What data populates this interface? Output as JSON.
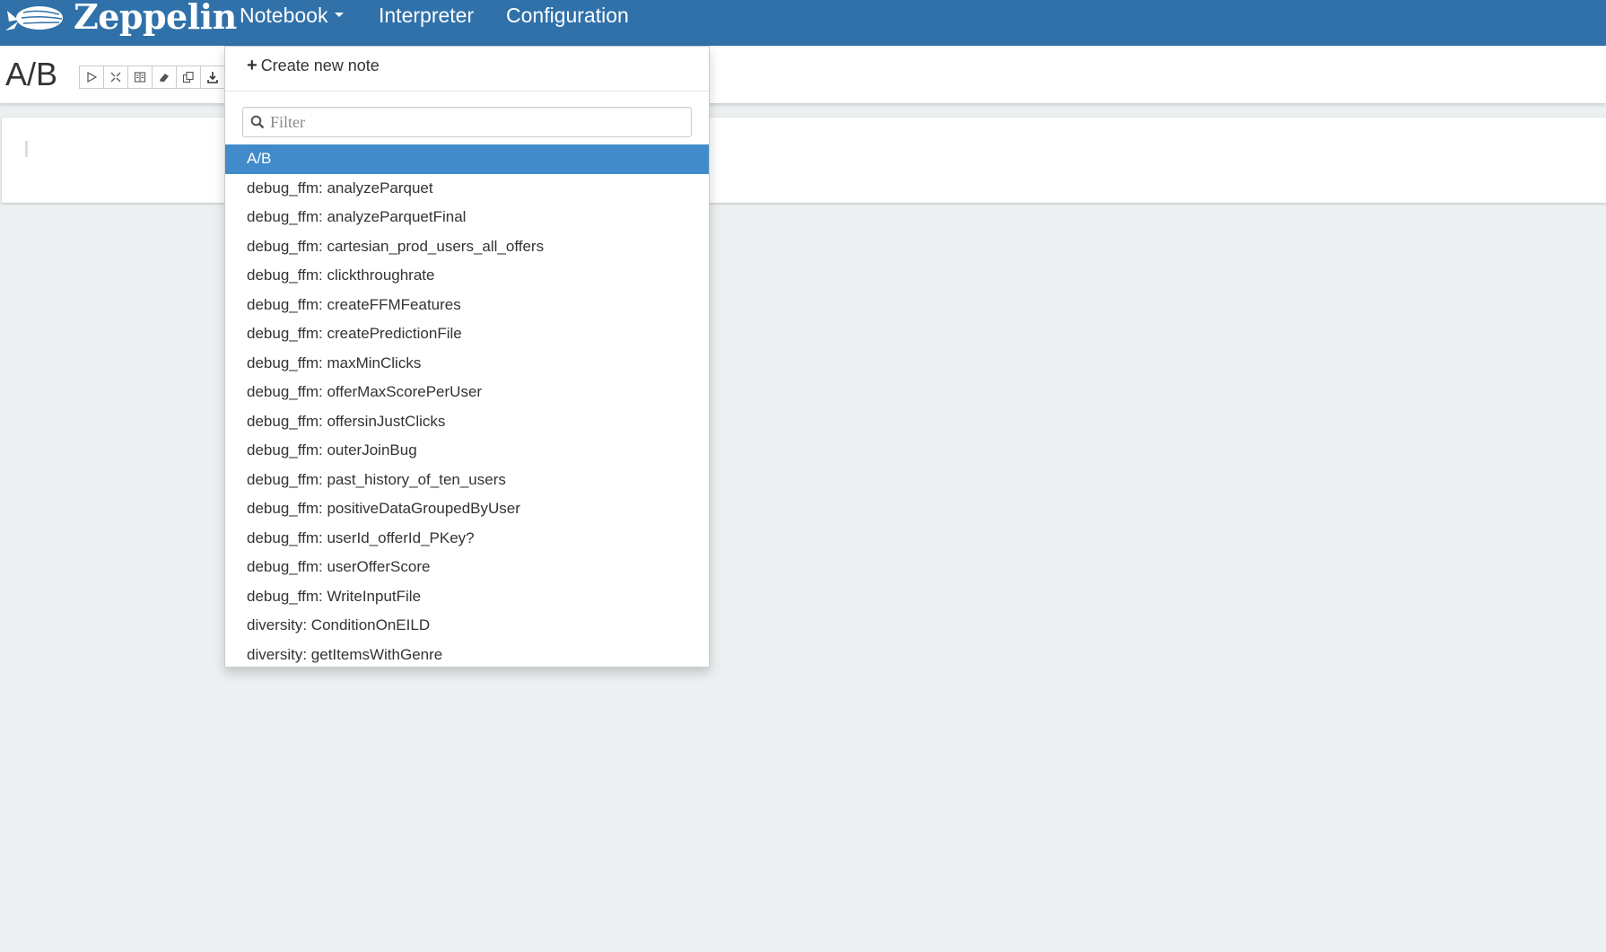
{
  "navbar": {
    "brand": "Zeppelin",
    "items": [
      {
        "label": "Notebook",
        "has_caret": true
      },
      {
        "label": "Interpreter"
      },
      {
        "label": "Configuration"
      }
    ]
  },
  "note": {
    "title": "A/B",
    "toolbar_icons": [
      "run-all-icon",
      "collapse-icon",
      "book-icon",
      "eraser-icon",
      "clone-icon",
      "export-icon"
    ]
  },
  "dropdown": {
    "create_label": "Create new note",
    "filter_placeholder": "Filter",
    "notes": [
      {
        "label": "A/B",
        "active": true
      },
      {
        "label": "debug_ffm: analyzeParquet"
      },
      {
        "label": "debug_ffm: analyzeParquetFinal"
      },
      {
        "label": "debug_ffm: cartesian_prod_users_all_offers"
      },
      {
        "label": "debug_ffm: clickthroughrate"
      },
      {
        "label": "debug_ffm: createFFMFeatures"
      },
      {
        "label": "debug_ffm: createPredictionFile"
      },
      {
        "label": "debug_ffm: maxMinClicks"
      },
      {
        "label": "debug_ffm: offerMaxScorePerUser"
      },
      {
        "label": "debug_ffm: offersinJustClicks"
      },
      {
        "label": "debug_ffm: outerJoinBug"
      },
      {
        "label": "debug_ffm: past_history_of_ten_users"
      },
      {
        "label": "debug_ffm: positiveDataGroupedByUser"
      },
      {
        "label": "debug_ffm: userId_offerId_PKey?"
      },
      {
        "label": "debug_ffm: userOfferScore"
      },
      {
        "label": "debug_ffm: WriteInputFile"
      },
      {
        "label": "diversity: ConditionOnEILD"
      },
      {
        "label": "diversity: getItemsWithGenre"
      }
    ]
  },
  "colors": {
    "navbar": "#3071a9",
    "active_item": "#428bca",
    "page_bg": "#ecf0f1"
  }
}
